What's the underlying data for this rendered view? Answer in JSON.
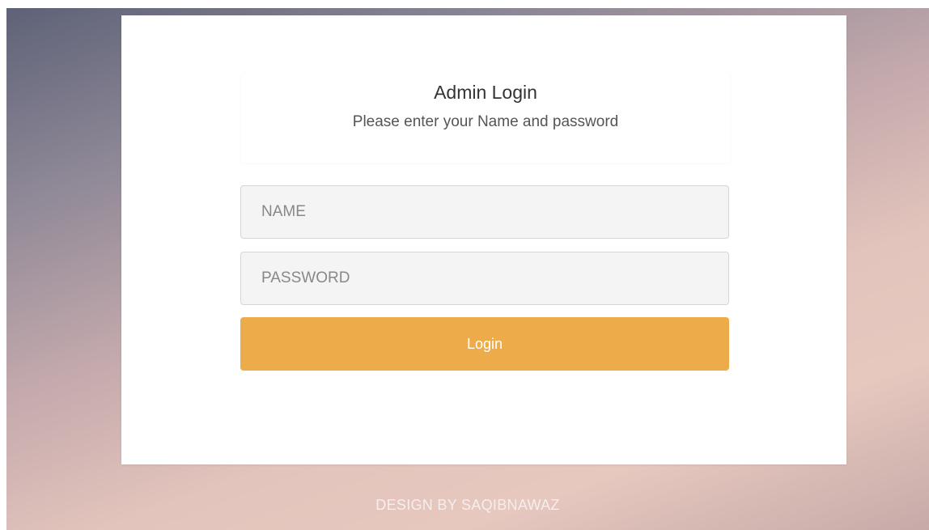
{
  "login": {
    "title": "Admin Login",
    "subtitle": "Please enter your Name and password",
    "name_placeholder": "NAME",
    "password_placeholder": "PASSWORD",
    "button_label": "Login"
  },
  "footer": {
    "credit": "DESIGN BY SAQIBNAWAZ"
  },
  "colors": {
    "button": "#edac4a",
    "card": "#ffffff",
    "field_background": "#f4f4f4"
  }
}
